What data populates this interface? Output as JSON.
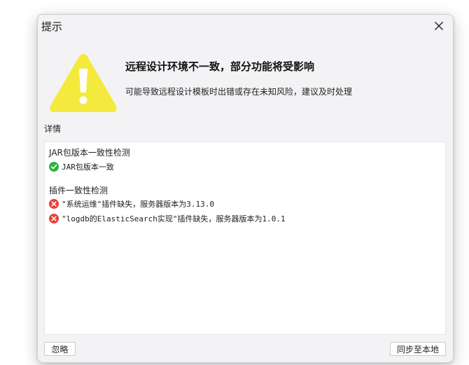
{
  "dialog": {
    "title": "提示",
    "headline": "远程设计环境不一致，部分功能将受影响",
    "subtext": "可能导致远程设计模板时出错或存在未知风险，建议及时处理",
    "details_label": "详情",
    "icons": {
      "warning": "warning-triangle-icon",
      "close": "close-icon",
      "ok": "check-circle-icon",
      "error": "error-circle-icon"
    },
    "colors": {
      "warning_yellow": "#f3ea3d",
      "ok_green": "#2fb344",
      "error_red": "#e8403b"
    }
  },
  "details": {
    "sections": [
      {
        "title": "JAR包版本一致性检测",
        "items": [
          {
            "status": "ok",
            "text": "JAR包版本一致"
          }
        ]
      },
      {
        "title": "插件一致性检测",
        "items": [
          {
            "status": "error",
            "text": "\"系统运维\"插件缺失，服务器版本为3.13.0"
          },
          {
            "status": "error",
            "text": "\"logdb的ElasticSearch实现\"插件缺失，服务器版本为1.0.1"
          }
        ]
      }
    ]
  },
  "buttons": {
    "ignore_label": "忽略",
    "sync_label": "同步至本地"
  }
}
